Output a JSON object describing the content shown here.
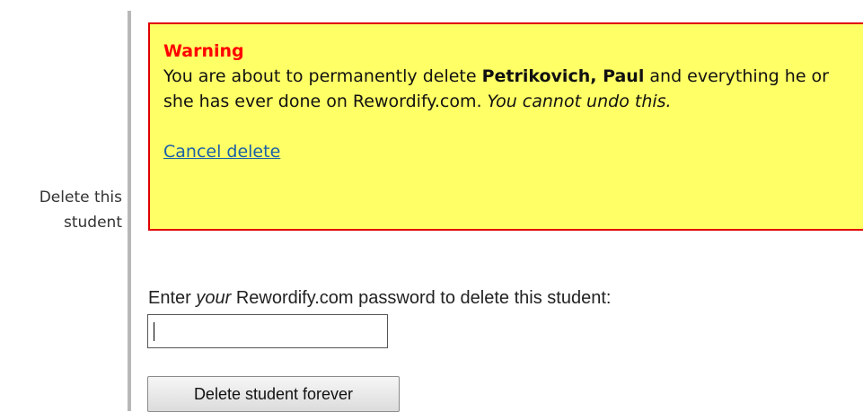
{
  "row_label": "Delete this student",
  "warning": {
    "title": "Warning",
    "text_before_name": "You are about to permanently delete ",
    "student_name": "Petrikovich, Paul",
    "text_after_name": " and everything he or she has ever done on Rewordify.com. ",
    "cannot_undo": "You cannot undo this.",
    "cancel_link": "Cancel delete"
  },
  "password": {
    "label_before": "Enter ",
    "label_emphasis": "your",
    "label_after": " Rewordify.com password to delete this student:",
    "value": ""
  },
  "delete_button": {
    "label": "Delete student forever"
  },
  "colors": {
    "warning_background": "#ffff66",
    "warning_border": "#e00000",
    "warning_title": "#ff0000",
    "link": "#1a5fa8"
  }
}
